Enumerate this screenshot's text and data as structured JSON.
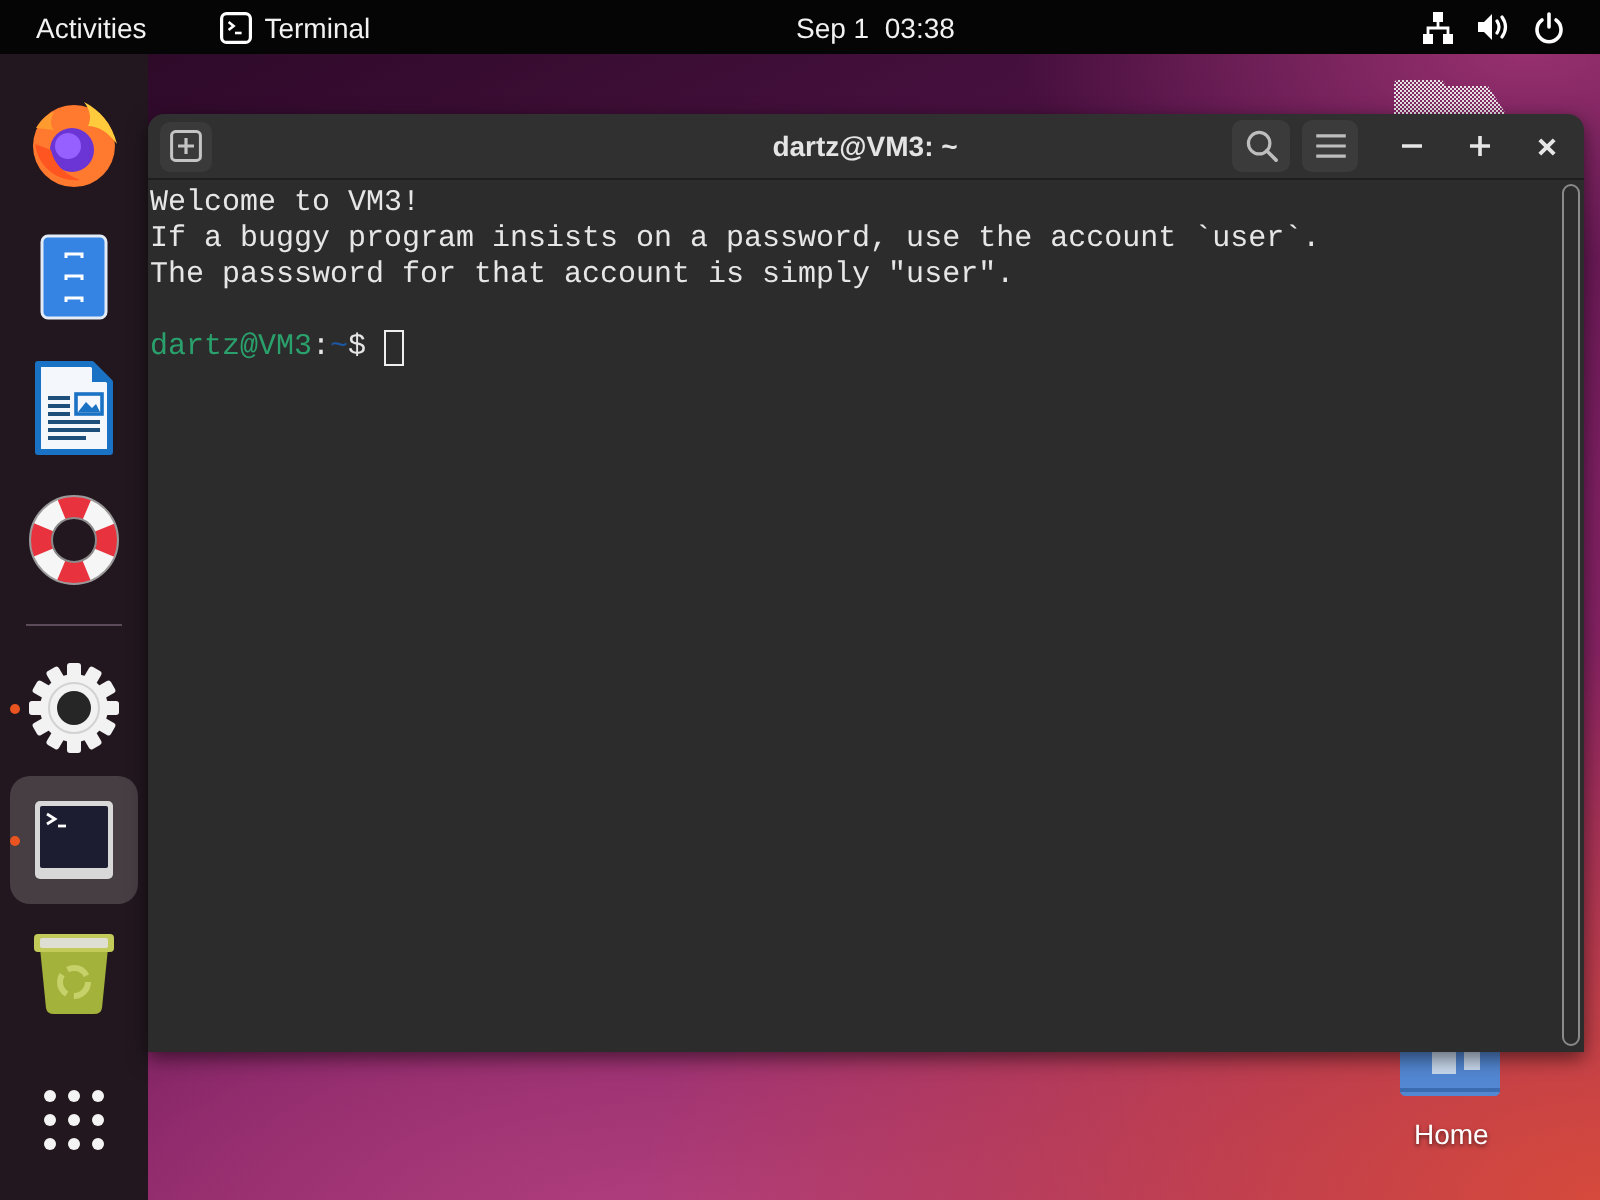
{
  "top_bar": {
    "activities": "Activities",
    "app_menu": "Terminal",
    "clock": "Sep 1  03:38"
  },
  "dock": {
    "items": [
      {
        "kind": "browser",
        "running": false,
        "selected": false
      },
      {
        "kind": "files",
        "running": false,
        "selected": false
      },
      {
        "kind": "writer",
        "running": false,
        "selected": false
      },
      {
        "kind": "help",
        "running": false,
        "selected": false
      },
      {
        "kind": "separator"
      },
      {
        "kind": "settings",
        "running": true,
        "selected": false
      },
      {
        "kind": "terminal",
        "running": true,
        "selected": true
      },
      {
        "kind": "trash",
        "running": false,
        "selected": false
      },
      {
        "kind": "app_grid",
        "selected": false
      }
    ]
  },
  "window": {
    "title": "dartz@VM3: ~",
    "output": [
      "Welcome to VM3!",
      "If a buggy program insists on a password, use the account `user`.",
      "The passsword for that account is simply \"user\"."
    ],
    "prompt": {
      "user_host": "dartz@VM3",
      "separator": ":",
      "path": "~",
      "symbol": "$"
    }
  },
  "desktop": {
    "home_label": "Home"
  }
}
